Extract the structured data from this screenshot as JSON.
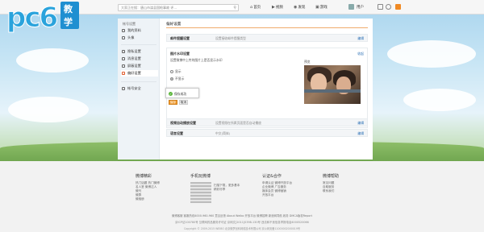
{
  "brand": {
    "logo_text": "pc6",
    "logo_badge": "教学"
  },
  "search": {
    "placeholder": "大家正在搜：唐山市滦县国枪事故 评..."
  },
  "nav": {
    "home": "首页",
    "video": "视频",
    "discover": "发现",
    "game": "游戏",
    "user_name": "用户"
  },
  "sidebar": {
    "title": "帐号设置",
    "items": [
      {
        "label": "我的资料"
      },
      {
        "label": "头像"
      },
      {
        "label": "隐私设置"
      },
      {
        "label": "消息设置"
      },
      {
        "label": "屏蔽设置"
      },
      {
        "label": "偏好设置"
      },
      {
        "label": "帐号安全"
      }
    ]
  },
  "content": {
    "title": "偏好设置",
    "row_language": {
      "label": "邮件提醒设置",
      "value": "设置接收邮件提醒类型",
      "edit": "编辑"
    },
    "section": {
      "heading": "图片水印设置",
      "close": "收起",
      "question": "设置微博中上传的图片上是否显示水印",
      "radio_show": "显示",
      "radio_hide": "不显示",
      "preview_label": "预览"
    },
    "toast": "保存成功",
    "save_label": "保存",
    "cancel_label": "取消",
    "row_video": {
      "label": "视频自动播放设置",
      "value": "设置视频在所属页面是否自动播放",
      "edit": "编辑"
    },
    "row_lang": {
      "label": "语言设置",
      "value": "中文(简体)",
      "edit": "编辑"
    }
  },
  "footer": {
    "col1": {
      "title": "微博精彩",
      "links": [
        "热门话题  热门微博",
        "名人堂  微博达人",
        "微刊",
        "微群",
        "微相册"
      ]
    },
    "col2": {
      "title": "手机玩微博",
      "qr_text": [
        "扫描下载，更多基本",
        "精彩尽享"
      ]
    },
    "col3": {
      "title": "认证&合作",
      "links": [
        "申请认证  微博开放平台",
        "企业微博  广告服务",
        "媒体会员  微博营销",
        "开放平台"
      ]
    },
    "col4": {
      "title": "微博帮助",
      "links": [
        "常见问题",
        "自助服务",
        "联系我们"
      ]
    },
    "line1": "微博客服  客服热线4000-960-960  意见反馈  About Weibo  开放平台  微博招聘  新浪网导航  政务  DMCA版权Report",
    "line2": "京ICP证100780号  互联网药品服务许可证  京网文[2011]0398-130号  违法和不良信息举报电话4000520066",
    "line3": "Copyright © 2009-2015 WEIBO 北京微梦创科网络技术有限公司  京公网安备11000002000019号"
  },
  "colors": {
    "accent": "#f09a2e",
    "link": "#2a6fb5",
    "brand": "#2aa3dc"
  }
}
